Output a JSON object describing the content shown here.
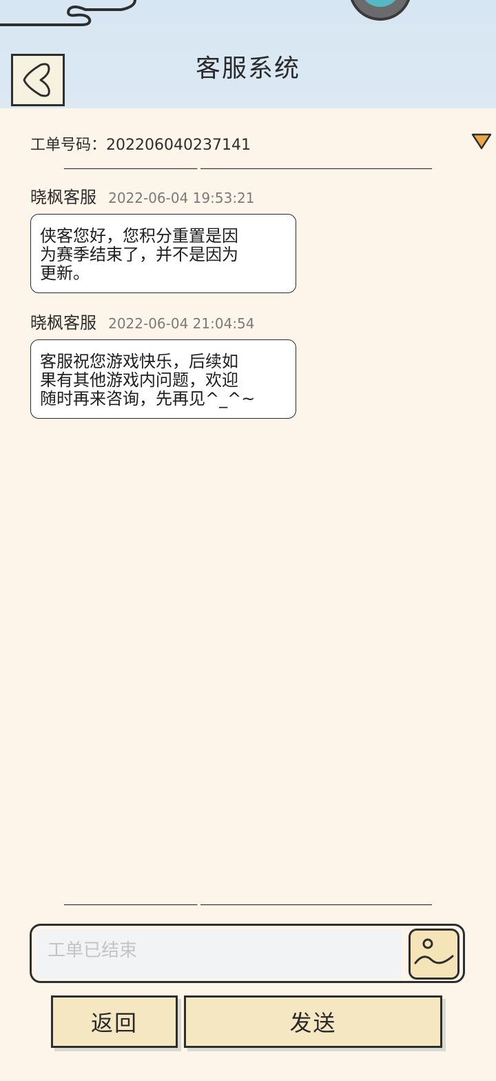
{
  "header": {
    "title": "客服系统",
    "back_icon": "back-arrow-icon"
  },
  "ticket": {
    "label": "工单号码：202206040237141",
    "expand_icon": "triangle-down-icon"
  },
  "messages": [
    {
      "sender": "晓枫客服",
      "time": "2022-06-04 19:53:21",
      "lines": [
        "侠客您好，您积分重置是因",
        "为赛季结束了，并不是因为",
        "更新。"
      ]
    },
    {
      "sender": "晓枫客服",
      "time": "2022-06-04 21:04:54",
      "lines": [
        "客服祝您游戏快乐，后续如",
        "果有其他游戏内问题，欢迎",
        "随时再来咨询，先再见^_^~"
      ]
    }
  ],
  "composer": {
    "placeholder": "工单已结束",
    "image_icon": "image-upload-icon"
  },
  "buttons": {
    "back_label": "返回",
    "send_label": "发送"
  },
  "colors": {
    "header_bg": "#d6e6f2",
    "page_bg": "#fdf5ea",
    "button_bg": "#f6e7c3",
    "arrow_fill": "#e8a84a"
  }
}
